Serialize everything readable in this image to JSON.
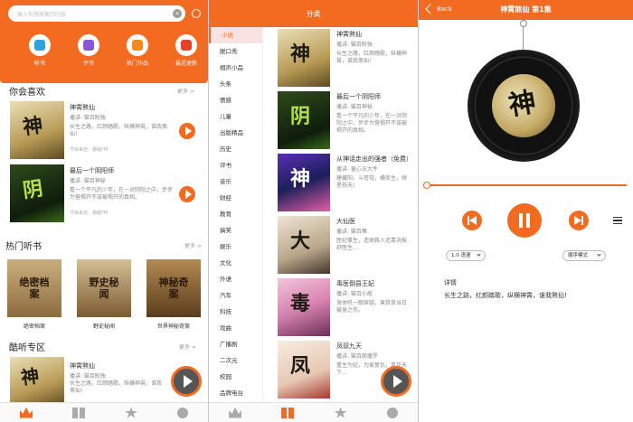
{
  "panel1": {
    "search_placeholder": "输入你想搜索的内容",
    "quick_nav": [
      {
        "label": "听书",
        "icon": "headphones-icon",
        "color": "#2fa3e0"
      },
      {
        "label": "评书",
        "icon": "book-icon",
        "color": "#8a55d6"
      },
      {
        "label": "热门作品",
        "icon": "hot-list-icon",
        "color": "#f58b1f"
      },
      {
        "label": "最近更新",
        "icon": "update-icon",
        "color": "#e8412a"
      }
    ],
    "sections": {
      "like": "你会喜欢",
      "hot": "热门听书",
      "cool": "酷听专区"
    },
    "more": "更多 >",
    "like_items": [
      {
        "title": "神霄煞仙",
        "reader": "播讲: 猫百盼独",
        "desc": "长生之路，红颜踏歌，纵横神霄，谁我煞仙!",
        "source": "节目来自：蜻蜓FM"
      },
      {
        "title": "最后一个阴阳师",
        "reader": "播讲: 猫百神秘",
        "desc": "看一个平凡的少年，在一对阴阳之中，步步为营揭开不该被揭开的真相。",
        "source": "节目来自：蜻蜓FM"
      }
    ],
    "hot_items": [
      {
        "title": "绝密档案",
        "cover": "绝密档案"
      },
      {
        "title": "野史秘闻",
        "cover": "野史秘闻"
      },
      {
        "title": "世界神秘奇案",
        "cover": "神秘奇案"
      }
    ],
    "cool_item": {
      "title": "神霄煞仙",
      "reader": "播讲: 猫百盼独",
      "desc": "长生之路，红颜踏歌，纵横神霄，谁我煞仙!"
    }
  },
  "panel2": {
    "header_title": "分类",
    "categories": [
      "小说",
      "脱口秀",
      "相声小品",
      "头条",
      "情感",
      "儿童",
      "出版精品",
      "历史",
      "评书",
      "音乐",
      "财经",
      "教育",
      "搞笑",
      "娱乐",
      "文化",
      "外语",
      "汽车",
      "科技",
      "戏曲",
      "广播剧",
      "二次元",
      "校园",
      "品牌电台"
    ],
    "books": [
      {
        "title": "神霄煞仙",
        "reader": "播讲: 猫百盼独",
        "desc": "长生之路，红颜踏歌，纵横神霄，谁我煞仙!"
      },
      {
        "title": "最后一个阴阳师",
        "reader": "播讲: 猫百神秘",
        "desc": "看一个平凡的少年，在一对阴阳之中，步步为营揭开不该被揭开的真相。"
      },
      {
        "title": "从神话走出的强者（免费）",
        "reader": "播讲: 童心五大件",
        "desc": "建藏阳，斗苍穹，横条生，倾星杨天!"
      },
      {
        "title": "大仙医",
        "reader": "播讲: 猫百舞",
        "desc": "医纪事生，造病救人还靠消报舒医生..."
      },
      {
        "title": "毒医倒县王妃",
        "reader": "播讲: 猫百小故",
        "desc": "身体吼一眼穿越，竟我背当日被身之伤。"
      },
      {
        "title": "凤驭九天",
        "reader": "播讲: 猫百阁播罗",
        "desc": "重生为妃，为爱复仇，风华天下..."
      }
    ]
  },
  "panel3": {
    "back_label": "Back",
    "title": "神霄煞仙 第1集",
    "speed": "1.0 语速",
    "mode": "顺序模式",
    "detail_label": "详情",
    "detail_text": "长生之路，红颜踏歌，纵横神霄，谁我煞仙!",
    "progress": 0.0
  },
  "tabs": [
    "home-tab-icon",
    "category-tab-icon",
    "favorite-tab-icon",
    "settings-tab-icon"
  ]
}
